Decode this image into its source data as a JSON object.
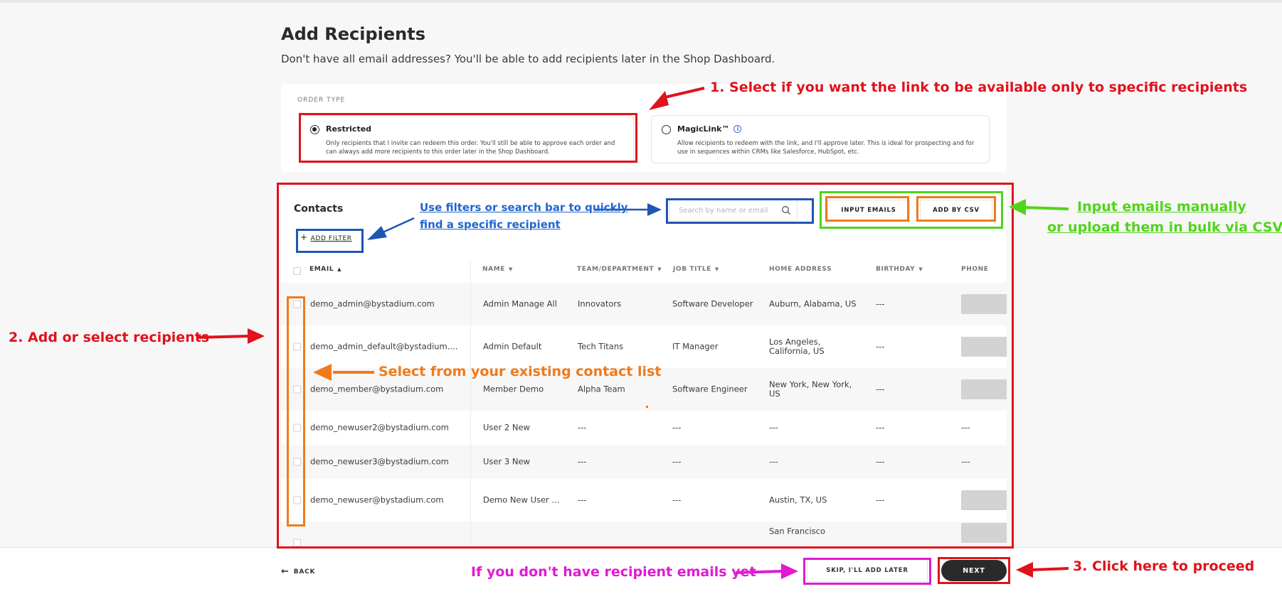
{
  "page": {
    "title": "Add Recipients",
    "subtitle": "Don't have all email addresses? You'll be able to add recipients later in the Shop Dashboard."
  },
  "order_type": {
    "label": "ORDER TYPE",
    "options": [
      {
        "title": "Restricted",
        "selected": true,
        "description": "Only recipients that I invite can redeem this order. You'll still be able to approve each order and can always add more recipients to this order later in the Shop Dashboard."
      },
      {
        "title": "MagicLink™",
        "selected": false,
        "icon": "info-icon",
        "info_glyph": "i",
        "description": "Allow recipients to redeem with the link, and I'll approve later. This is ideal for prospecting and for use in sequences within CRMs like Salesforce, HubSpot, etc."
      }
    ]
  },
  "contacts": {
    "title": "Contacts",
    "add_filter_label": "ADD FILTER",
    "add_filter_glyph": "+",
    "search_placeholder": "Search by name or email",
    "input_emails_label": "INPUT EMAILS",
    "add_by_csv_label": "ADD BY CSV",
    "columns": [
      {
        "label": "EMAIL",
        "caret": "▲"
      },
      {
        "label": "NAME",
        "caret": "▼"
      },
      {
        "label": "TEAM/DEPARTMENT",
        "caret": "▼"
      },
      {
        "label": "JOB TITLE",
        "caret": "▼"
      },
      {
        "label": "HOME ADDRESS",
        "caret": ""
      },
      {
        "label": "BIRTHDAY",
        "caret": "▼"
      },
      {
        "label": "PHONE",
        "caret": ""
      }
    ],
    "rows": [
      {
        "email": "demo_admin@bystadium.com",
        "name": "Admin Manage All",
        "team": "Innovators",
        "job": "Software Developer",
        "address": "Auburn, Alabama, US",
        "birthday": "---",
        "phone": ""
      },
      {
        "email": "demo_admin_default@bystadium....",
        "name": "Admin Default",
        "team": "Tech Titans",
        "job": "IT Manager",
        "address": "Los Angeles, California, US",
        "birthday": "---",
        "phone": ""
      },
      {
        "email": "demo_member@bystadium.com",
        "name": "Member Demo",
        "team": "Alpha Team",
        "job": "Software Engineer",
        "address": "New York, New York, US",
        "birthday": "---",
        "phone": ""
      },
      {
        "email": "demo_newuser2@bystadium.com",
        "name": "User 2 New",
        "team": "---",
        "job": "---",
        "address": "---",
        "birthday": "---",
        "phone": "---"
      },
      {
        "email": "demo_newuser3@bystadium.com",
        "name": "User 3 New",
        "team": "---",
        "job": "---",
        "address": "---",
        "birthday": "---",
        "phone": "---"
      },
      {
        "email": "demo_newuser@bystadium.com",
        "name": "Demo New User ...",
        "team": "---",
        "job": "---",
        "address": "Austin, TX, US",
        "birthday": "---",
        "phone": ""
      },
      {
        "email": "",
        "name": "",
        "team": "",
        "job": "",
        "address": "San Francisco",
        "birthday": "",
        "phone": ""
      }
    ]
  },
  "footer": {
    "back_label": "BACK",
    "back_glyph": "←",
    "skip_label": "SKIP, I'LL ADD LATER",
    "next_label": "NEXT"
  },
  "annotations": {
    "step1": "1. Select if you want the link to be available only to specific recipients",
    "step2": "2. Add or select recipients",
    "step3": "3. Click here to proceed",
    "filters_line1": "Use filters or search bar to quickly",
    "filters_line2": "find a specific recipient",
    "input_line1": "Input emails manually",
    "input_line2": "or upload them in bulk via CSV",
    "select_existing": "Select from your existing contact list",
    "no_emails": "If you don't have recipient emails yet"
  },
  "colors": {
    "annotation_red": "#e0121b",
    "annotation_blue": "#1f55b5",
    "annotation_orange": "#f07a1a",
    "annotation_green": "#52d41a",
    "annotation_magenta": "#e01ad0",
    "next_button": "#2a2a2a"
  }
}
